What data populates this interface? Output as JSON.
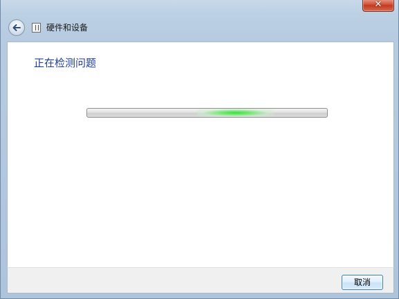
{
  "window": {
    "close_symbol": "✕"
  },
  "nav": {
    "back_icon": "back-arrow-icon",
    "title": "硬件和设备"
  },
  "content": {
    "heading": "正在检测问题",
    "progress": {
      "state": "indeterminate",
      "glow_position_fraction": 0.62,
      "glow_color": "#3ddc3d"
    }
  },
  "footer": {
    "cancel_label": "取消"
  },
  "colors": {
    "heading": "#1e3f9a",
    "close_button": "#c23a1f",
    "chrome": "#bcd0e4"
  }
}
